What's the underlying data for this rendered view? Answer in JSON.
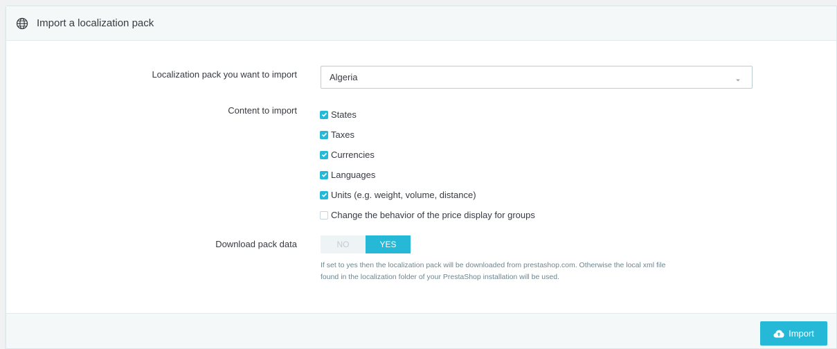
{
  "panel": {
    "title": "Import a localization pack",
    "icon": "globe-icon"
  },
  "form": {
    "pack_label": "Localization pack you want to import",
    "pack_selected": "Algeria",
    "content_label": "Content to import",
    "content_items": [
      {
        "label": "States",
        "checked": true
      },
      {
        "label": "Taxes",
        "checked": true
      },
      {
        "label": "Currencies",
        "checked": true
      },
      {
        "label": "Languages",
        "checked": true
      },
      {
        "label": "Units (e.g. weight, volume, distance)",
        "checked": true
      },
      {
        "label": "Change the behavior of the price display for groups",
        "checked": false
      }
    ],
    "download_label": "Download pack data",
    "download_no": "NO",
    "download_yes": "YES",
    "download_value": "YES",
    "download_help_1": "If set to yes then the localization pack will be downloaded from prestashop.com. Otherwise the local xml file",
    "download_help_2": "found in the localization folder of your PrestaShop installation will be used."
  },
  "footer": {
    "import_label": "Import",
    "import_icon": "cloud-upload-icon"
  },
  "colors": {
    "accent": "#25b9d7",
    "text": "#363a41",
    "help_text": "#6c868e"
  }
}
